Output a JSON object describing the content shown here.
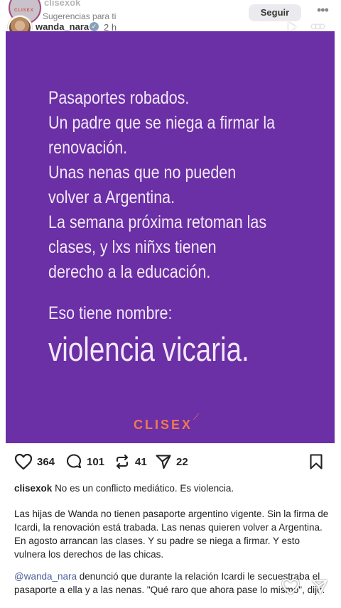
{
  "background_post": {
    "username": "clisexok",
    "suggestion": "Sugerencias para ti",
    "follow_label": "Seguir",
    "more": "•••",
    "logo_text": "CLISEX"
  },
  "story": {
    "username": "wanda_nara",
    "verified_mark": "✓",
    "time": "2 h",
    "more": "•••"
  },
  "panel": {
    "color": "#6b2fa6",
    "lines": [
      "Pasaportes robados.",
      "Un padre que se niega a firmar la",
      "renovación.",
      "Unas nenas que no pueden",
      "volver a Argentina.",
      "La semana próxima retoman las",
      "clases, y lxs niñxs tienen",
      "derecho a la educación."
    ],
    "nombre": "Eso tiene nombre:",
    "headline": "violencia vicaria.",
    "logo": "CLISEX"
  },
  "actions": {
    "likes": "364",
    "comments": "101",
    "reposts": "41",
    "shares": "22"
  },
  "caption": {
    "username": "clisexok",
    "text": "No es un conflicto mediático. Es violencia."
  },
  "body": {
    "paragraph1": "Las hijas de Wanda no tienen pasaporte argentino vigente. Sin la firma de Icardi, la renovación está trabada. Las nenas quieren volver a Argentina. En agosto arrancan las clases. Y su padre se niega a firmar. Y esto vulnera los derechos de las chicas.",
    "mention": "@wanda_nara",
    "paragraph2": "denunció que durante la relación Icardi le secuestraba el pasaporte a ella y a las nenas. \"Qué raro que ahora pase lo mismo\", dijo."
  }
}
